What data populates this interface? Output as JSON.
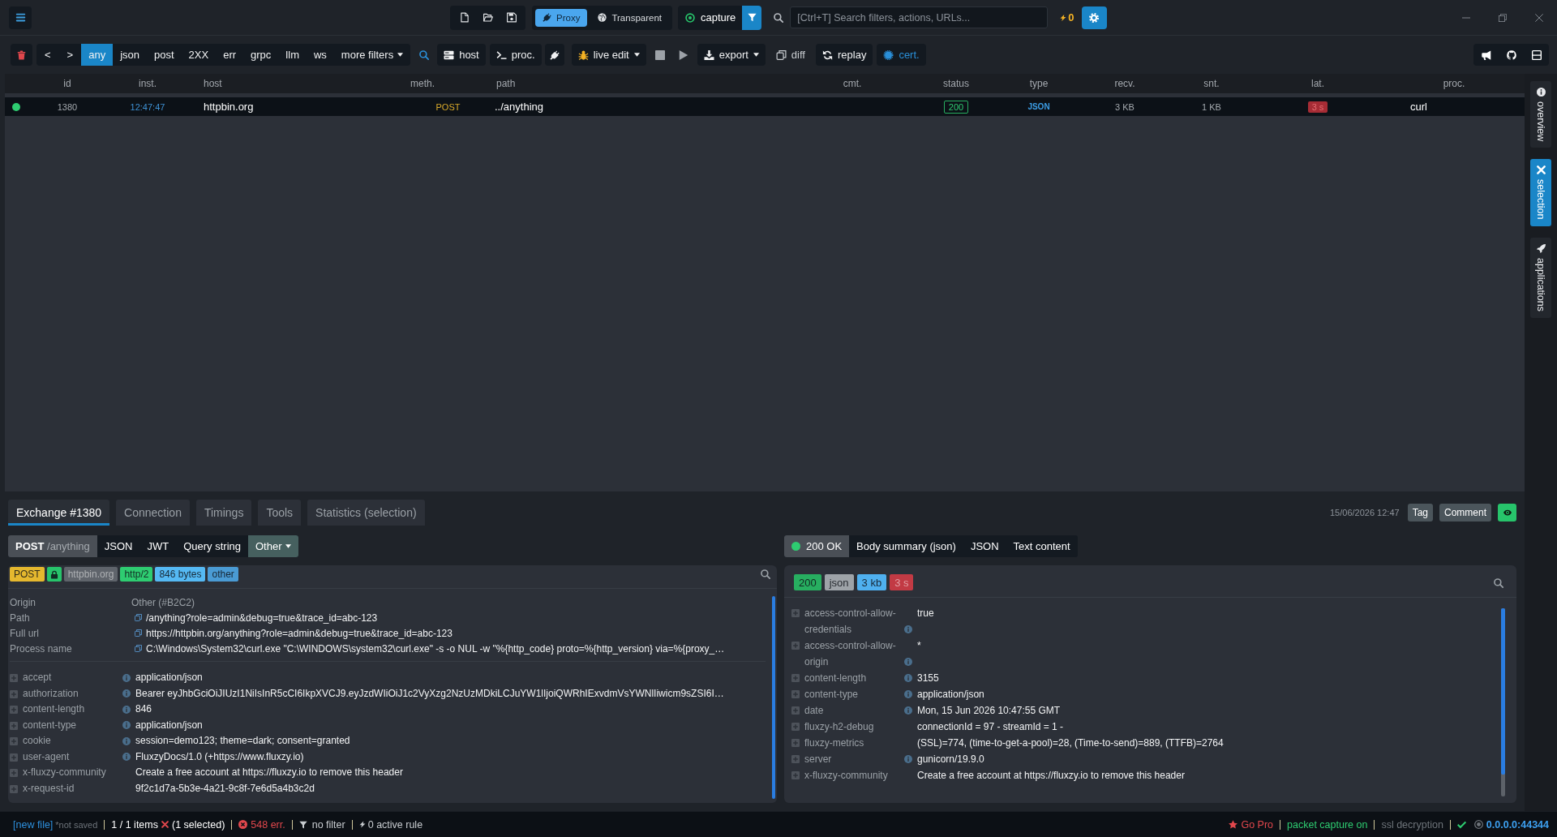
{
  "titlebar": {
    "modes": [
      {
        "label": "Proxy",
        "selected": true
      },
      {
        "label": "Transparent",
        "selected": false
      }
    ],
    "capture": {
      "label": "capture",
      "on": true
    },
    "search": {
      "placeholder": "[Ctrl+T] Search filters, actions, URLs..."
    },
    "alerts": "0"
  },
  "toolbar": {
    "nav": [
      "<",
      ">"
    ],
    "filters": [
      {
        "label": "any",
        "selected": true
      },
      {
        "label": "json",
        "selected": false
      },
      {
        "label": "post",
        "selected": false
      },
      {
        "label": "2XX",
        "selected": false
      },
      {
        "label": "err",
        "selected": false
      },
      {
        "label": "grpc",
        "selected": false
      },
      {
        "label": "llm",
        "selected": false
      },
      {
        "label": "ws",
        "selected": false
      }
    ],
    "more_filters": "more filters",
    "host": "host",
    "process": "proc.",
    "live_edit": "live edit",
    "export": "export",
    "diff": "diff",
    "replay": "replay",
    "certificate": "cert."
  },
  "table": {
    "columns": [
      "id",
      "inst.",
      "host",
      "meth.",
      "path",
      "cmt.",
      "status",
      "type",
      "recv.",
      "snt.",
      "lat.",
      "proc."
    ],
    "rows": [
      {
        "selected": true,
        "color": "#2ecc71",
        "id": "1380",
        "time": "12:47:47",
        "host": "httpbin.org",
        "method": "POST",
        "path": "../anything",
        "status": "200",
        "type": "JSON",
        "received": "3 KB",
        "sent": "1 KB",
        "latency": "3 s",
        "process": "curl"
      }
    ]
  },
  "sidebar": {
    "items": [
      {
        "label": "overview",
        "selected": false
      },
      {
        "label": "selection",
        "selected": true
      },
      {
        "label": "applications",
        "selected": false
      }
    ]
  },
  "details": {
    "tabs": [
      {
        "label": "Exchange #1380",
        "selected": true
      },
      {
        "label": "Connection",
        "selected": false
      },
      {
        "label": "Timings",
        "selected": false
      },
      {
        "label": "Tools",
        "selected": false
      },
      {
        "label": "Statistics (selection)",
        "selected": false
      }
    ],
    "date": "15/06/2026 12:47",
    "actions": [
      "Tag",
      "Comment"
    ],
    "request": {
      "tabs": [
        {
          "kind": "tab",
          "label": "**POST** /anything",
          "selected": true
        },
        {
          "kind": "tab",
          "label": "JSON",
          "selected": false
        },
        {
          "kind": "tab",
          "label": "JWT",
          "selected": false
        },
        {
          "kind": "tab",
          "label": "Query string",
          "selected": false
        },
        {
          "kind": "dropdown",
          "label": "Other",
          "selected": false
        }
      ],
      "badges": [
        {
          "kind": "text",
          "label": "POST",
          "color": "#e5b82e"
        },
        {
          "kind": "lock",
          "color": "#27c46b"
        },
        {
          "kind": "text",
          "label": "httpbin.org",
          "color": "#5f646b"
        },
        {
          "kind": "text",
          "label": "http/2",
          "color": "#2ecc71"
        },
        {
          "kind": "text",
          "label": "846 bytes",
          "color": "#55b9f3"
        },
        {
          "kind": "text",
          "label": "other",
          "color": "#4a9bd4"
        }
      ],
      "fields": [
        {
          "label": "Origin",
          "value": "Other (#B2C2)",
          "copyable": false
        },
        {
          "label": "Path",
          "value": "/anything?role=admin&debug=true&trace_id=abc-123",
          "copyable": true
        },
        {
          "label": "Full url",
          "value": "https://httpbin.org/anything?role=admin&debug=true&trace_id=abc-123",
          "copyable": true
        },
        {
          "label": "Process name",
          "value": "C:\\Windows\\System32\\curl.exe \"C:\\WINDOWS\\system32\\curl.exe\" -s -o NUL -w \"%{http_code} proto=%{http_version} via=%{proxy_…",
          "copyable": true
        }
      ],
      "headers": [
        {
          "name": "accept",
          "value": "application/json",
          "info": true
        },
        {
          "name": "authorization",
          "value": "Bearer eyJhbGciOiJIUzI1NiIsInR5cCI6IkpXVCJ9.eyJzdWIiOiJ1c2VyXzg2NzUzMDkiLCJuYW1lIjoiQWRhIExvdmVsYWNlIiwicm9sZSI6I…",
          "info": true
        },
        {
          "name": "content-length",
          "value": "846",
          "info": true
        },
        {
          "name": "content-type",
          "value": "application/json",
          "info": true
        },
        {
          "name": "cookie",
          "value": "session=demo123; theme=dark; consent=granted",
          "info": true
        },
        {
          "name": "user-agent",
          "value": "FluxzyDocs/1.0 (+https://www.fluxzy.io)",
          "info": true
        },
        {
          "name": "x-fluxzy-community",
          "value": "Create a free account at https://fluxzy.io to remove this header",
          "info": false
        },
        {
          "name": "x-request-id",
          "value": "9f2c1d7a-5b3e-4a21-9c8f-7e6d5a4b3c2d",
          "info": false
        }
      ]
    },
    "response": {
      "tabs": [
        {
          "kind": "status",
          "label": "200 OK",
          "selected": true,
          "color": "#2ecc71"
        },
        {
          "kind": "tab",
          "label": "Body summary (json)",
          "selected": false
        },
        {
          "kind": "tab",
          "label": "JSON",
          "selected": false
        },
        {
          "kind": "tab",
          "label": "Text content",
          "selected": false
        }
      ],
      "badges": [
        {
          "kind": "text",
          "label": "200",
          "color": "#27ae60"
        },
        {
          "kind": "text",
          "label": "json",
          "color": "#9ea3a8"
        },
        {
          "kind": "text",
          "label": "3 kb",
          "color": "#4fb0ef"
        },
        {
          "kind": "text",
          "label": "3 s",
          "color": "#c23a44"
        }
      ],
      "headers": [
        {
          "name": "access-control-allow-credentials",
          "value": "true",
          "info": true
        },
        {
          "name": "access-control-allow-origin",
          "value": "*",
          "info": true
        },
        {
          "name": "content-length",
          "value": "3155",
          "info": true
        },
        {
          "name": "content-type",
          "value": "application/json",
          "info": true
        },
        {
          "name": "date",
          "value": "Mon, 15 Jun 2026 10:47:55 GMT",
          "info": true
        },
        {
          "name": "fluxzy-h2-debug",
          "value": "connectionId = 97 - streamId = 1 -",
          "info": false
        },
        {
          "name": "fluxzy-metrics",
          "value": "(SSL)=774, (time-to-get-a-pool)=28, (Time-to-send)=889, (TTFB)=2764",
          "info": false
        },
        {
          "name": "server",
          "value": "gunicorn/19.9.0",
          "info": true
        },
        {
          "name": "x-fluxzy-community",
          "value": "Create a free account at https://fluxzy.io to remove this header",
          "info": false
        }
      ]
    }
  },
  "status_bar": {
    "file": "[new file]",
    "save_state": "*not saved",
    "items": "1 / 1 items",
    "selection": "(1 selected)",
    "errors": "548 err.",
    "filter": "no filter",
    "rules": "0 active rule",
    "pro": "Go Pro",
    "toggles": [
      {
        "label": "packet capture on",
        "on": true
      },
      {
        "label": "ssl decryption",
        "on": false
      }
    ],
    "address": "0.0.0.0:44344"
  }
}
